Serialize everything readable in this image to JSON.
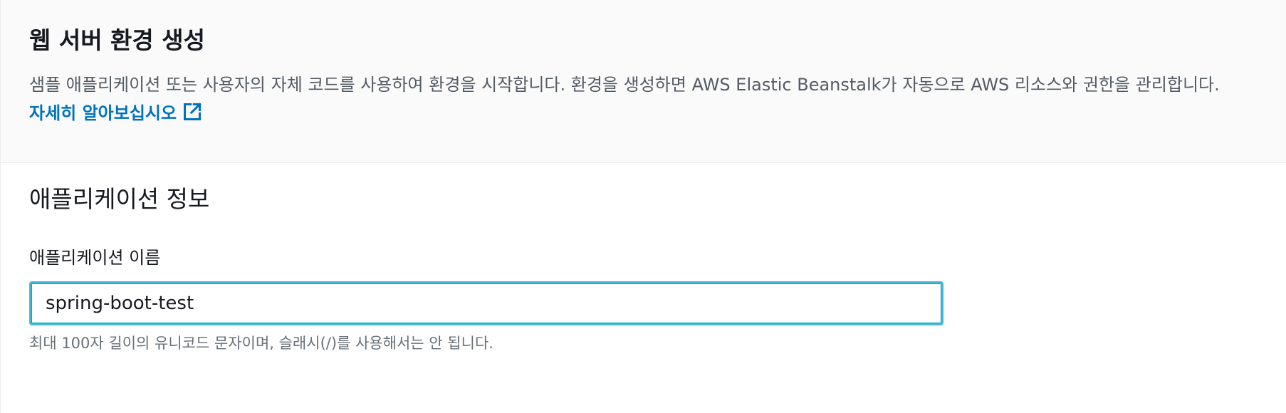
{
  "header": {
    "title": "웹 서버 환경 생성",
    "description": "샘플 애플리케이션 또는 사용자의 자체 코드를 사용하여 환경을 시작합니다. 환경을 생성하면 AWS Elastic Beanstalk가 자동으로 AWS 리소스와 권한을 관리합니다.",
    "learn_more": "자세히 알아보십시오",
    "learn_more_icon": "external-link-icon"
  },
  "app_info": {
    "section_title": "애플리케이션 정보",
    "name_label": "애플리케이션 이름",
    "name_value": "spring-boot-test",
    "name_constraint": "최대 100자 길이의 유니코드 문자이며, 슬래시(/)를 사용해서는 안 됩니다."
  },
  "colors": {
    "link": "#0073bb",
    "input_focus_border": "#44b9d6",
    "header_bg": "#fafafa"
  }
}
